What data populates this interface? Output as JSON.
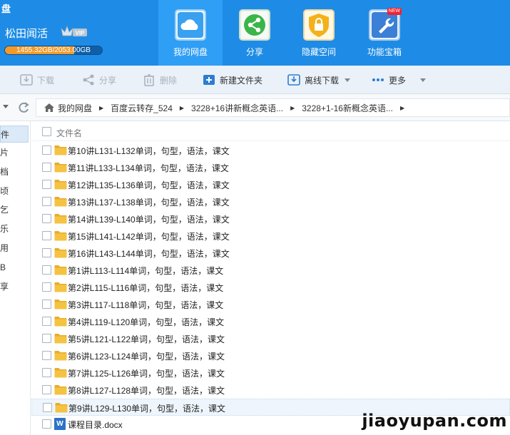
{
  "app": {
    "title": "盘"
  },
  "user": {
    "name": "松田闻活",
    "vip_label": "VIP",
    "quota_text": "1455.32GB/2053.00GB",
    "quota_fraction": 0.71
  },
  "nav": [
    {
      "label": "我的网盘",
      "icon": "cloud-icon",
      "active": true
    },
    {
      "label": "分享",
      "icon": "share-icon",
      "active": false
    },
    {
      "label": "隐藏空间",
      "icon": "lock-icon",
      "active": false
    },
    {
      "label": "功能宝箱",
      "icon": "wrench-icon",
      "active": false,
      "badge": "NEW"
    }
  ],
  "toolbar": {
    "download": "下载",
    "share": "分享",
    "delete": "删除",
    "new_folder": "新建文件夹",
    "offline_download": "离线下载",
    "more": "更多"
  },
  "breadcrumb": [
    "我的网盘",
    "百度云转存_524",
    "3228+16讲新概念英语...",
    "3228+1-16新概念英语..."
  ],
  "sidebar": [
    "件",
    "片",
    "档",
    "顷",
    "乞",
    "乐",
    "用",
    "B",
    "享"
  ],
  "list": {
    "header": "文件名",
    "rows": [
      {
        "name": "第10讲L131-L132单词，句型，语法，课文",
        "type": "folder"
      },
      {
        "name": "第11讲L133-L134单词，句型，语法，课文",
        "type": "folder"
      },
      {
        "name": "第12讲L135-L136单词，句型，语法，课文",
        "type": "folder"
      },
      {
        "name": "第13讲L137-L138单词，句型，语法，课文",
        "type": "folder"
      },
      {
        "name": "第14讲L139-L140单词，句型，语法，课文",
        "type": "folder"
      },
      {
        "name": "第15讲L141-L142单词，句型，语法，课文",
        "type": "folder"
      },
      {
        "name": "第16讲L143-L144单词，句型，语法，课文",
        "type": "folder"
      },
      {
        "name": "第1讲L113-L114单词，句型，语法，课文",
        "type": "folder"
      },
      {
        "name": "第2讲L115-L116单词，句型，语法，课文",
        "type": "folder"
      },
      {
        "name": "第3讲L117-L118单词，句型，语法，课文",
        "type": "folder"
      },
      {
        "name": "第4讲L119-L120单词，句型，语法，课文",
        "type": "folder"
      },
      {
        "name": "第5讲L121-L122单词，句型，语法，课文",
        "type": "folder"
      },
      {
        "name": "第6讲L123-L124单词，句型，语法，课文",
        "type": "folder"
      },
      {
        "name": "第7讲L125-L126单词，句型，语法，课文",
        "type": "folder"
      },
      {
        "name": "第8讲L127-L128单词，句型，语法，课文",
        "type": "folder"
      },
      {
        "name": "第9讲L129-L130单词，句型，语法，课文",
        "type": "folder",
        "highlighted": true
      },
      {
        "name": "课程目录.docx",
        "type": "docx",
        "icon_letter": "W"
      }
    ]
  },
  "watermark": "jiaoyupan.com",
  "colors": {
    "header_blue": "#1e8ce6",
    "active_nav": "#2f9ef5",
    "folder_yellow": "#f5c342",
    "quota_orange": "#f39a2a"
  }
}
